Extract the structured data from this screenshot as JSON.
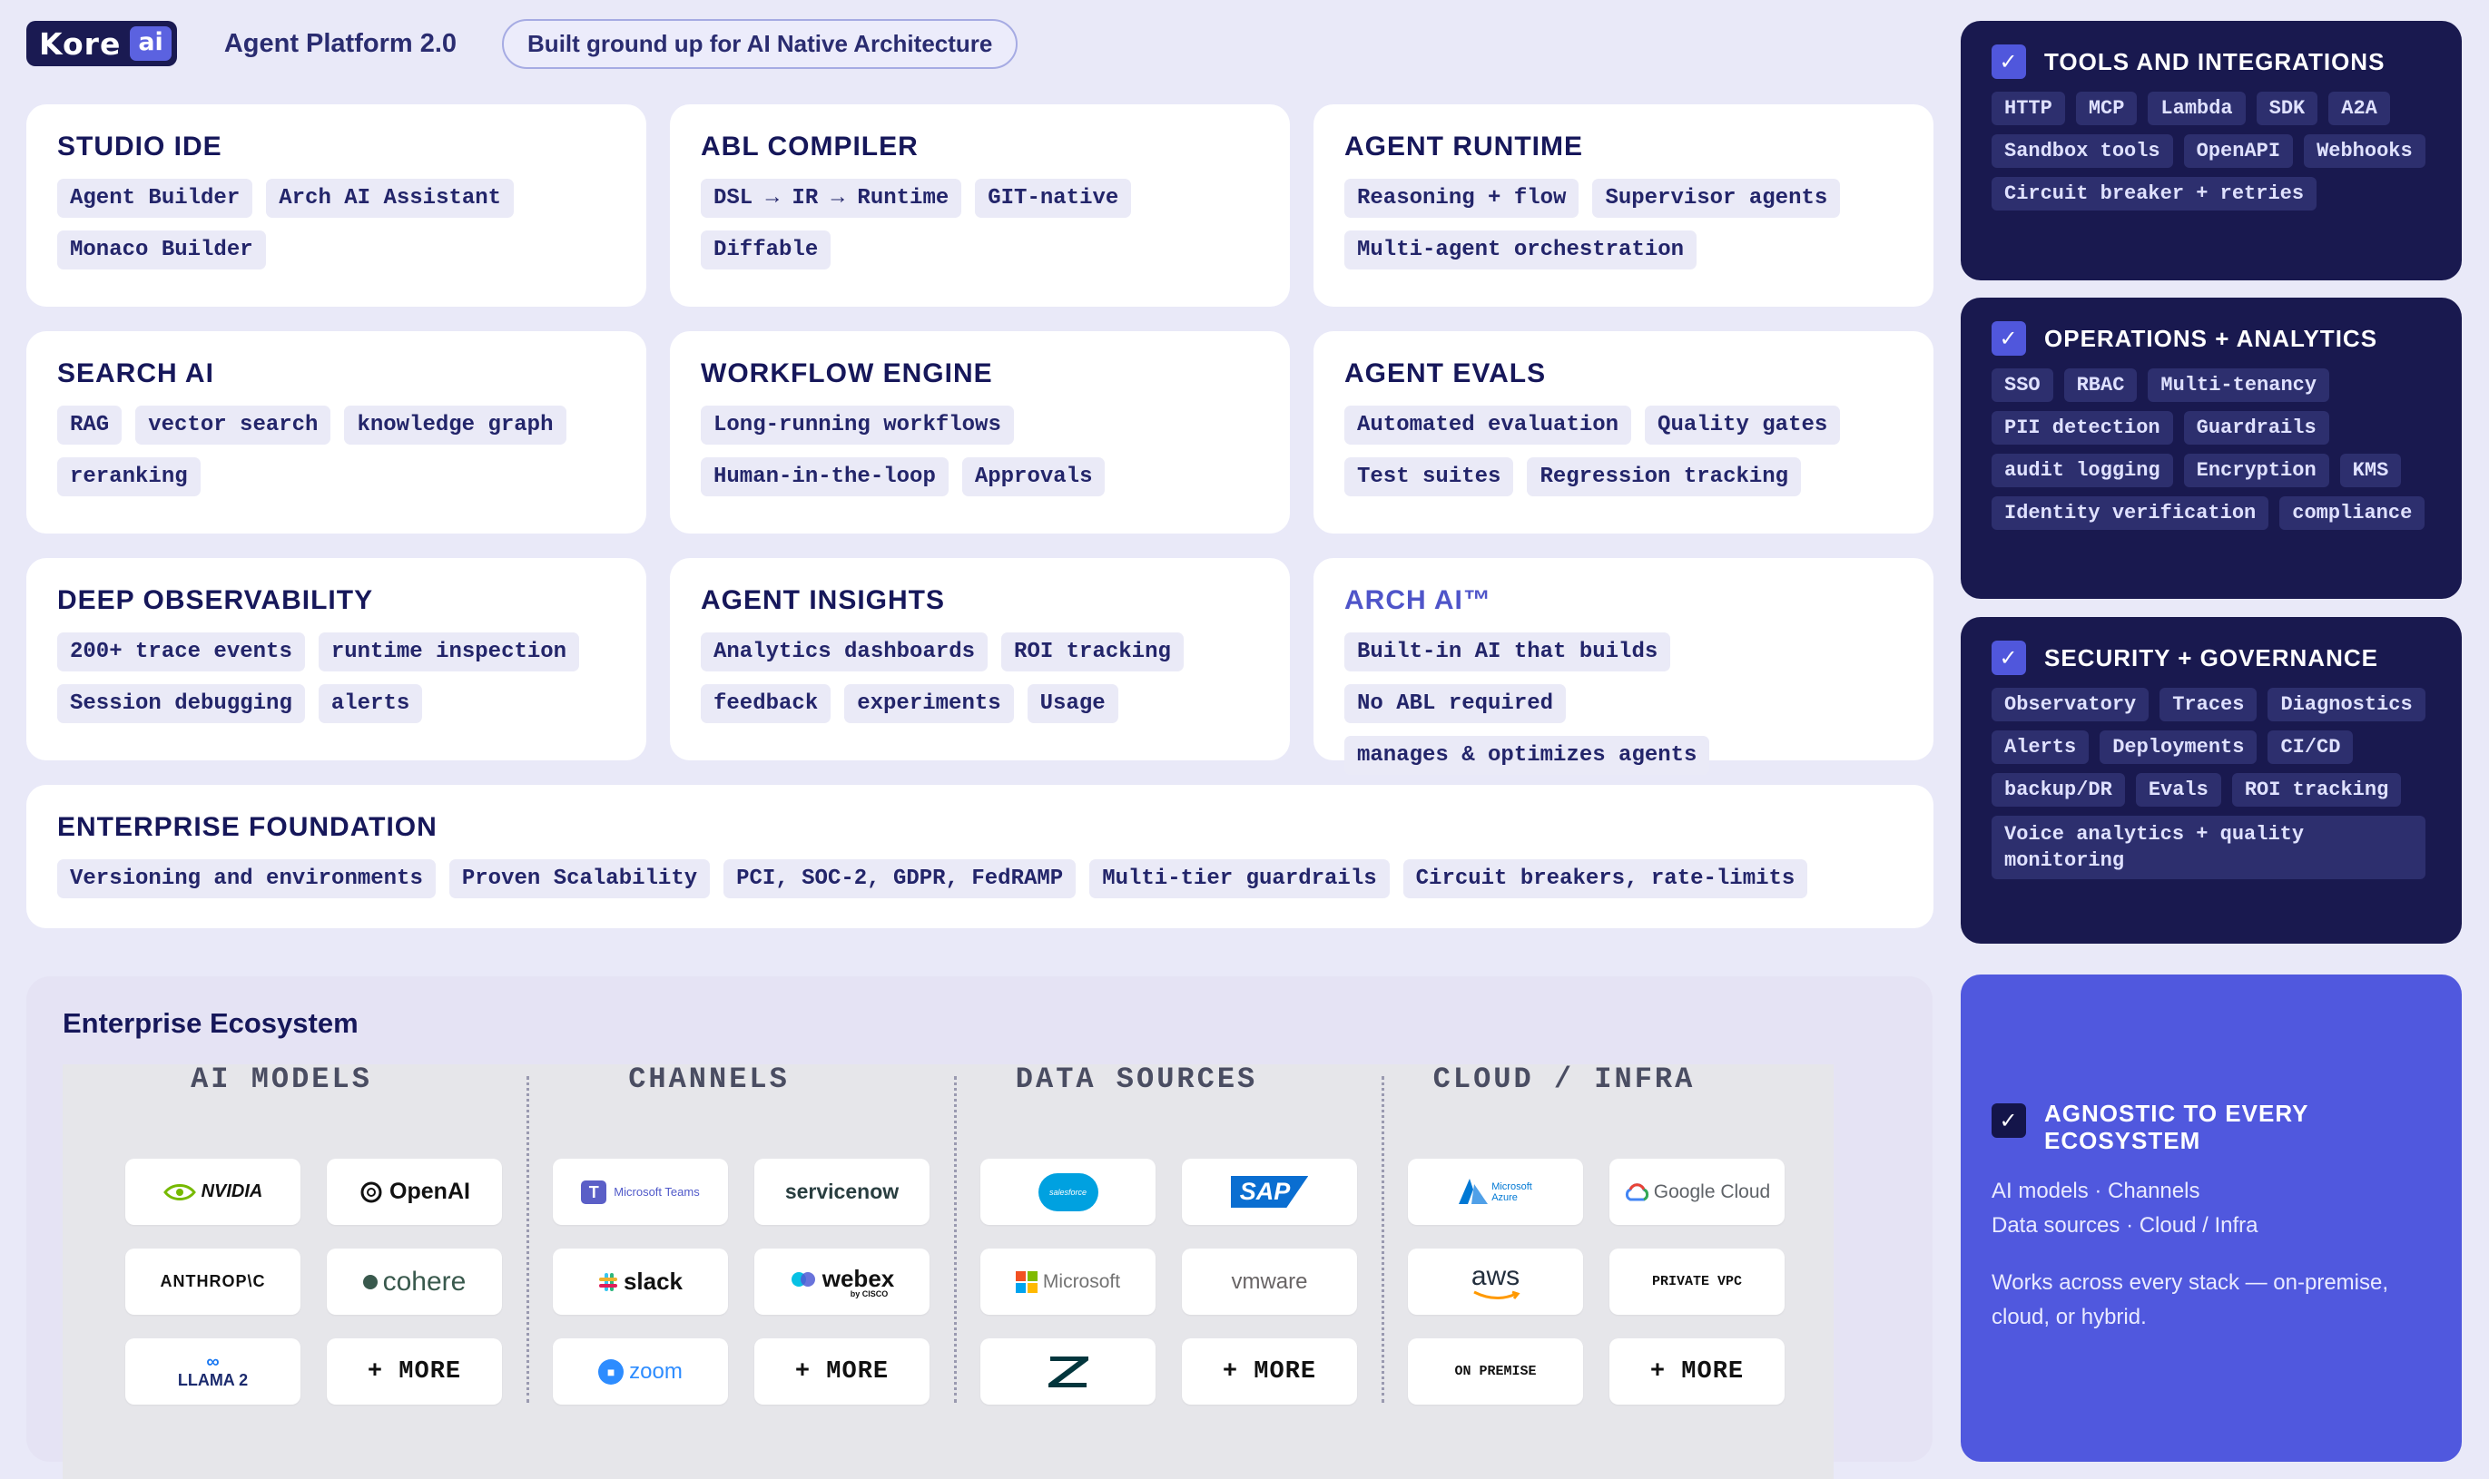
{
  "header": {
    "logo_word": "Kore",
    "logo_suffix": "ai",
    "platform": "Agent Platform 2.0",
    "tagline": "Built ground up for AI Native Architecture"
  },
  "cards": {
    "studio": {
      "title": "STUDIO IDE",
      "tags": [
        "Agent Builder",
        "Arch AI Assistant",
        "Monaco Builder"
      ]
    },
    "abl": {
      "title": "ABL COMPILER",
      "tags": [
        "DSL → IR → Runtime",
        "GIT-native",
        "Diffable"
      ]
    },
    "runtime": {
      "title": "AGENT RUNTIME",
      "tags": [
        "Reasoning + flow",
        "Supervisor agents",
        "Multi-agent orchestration"
      ]
    },
    "search": {
      "title": "SEARCH AI",
      "tags": [
        "RAG",
        "vector search",
        "knowledge graph",
        "reranking"
      ]
    },
    "workflow": {
      "title": "WORKFLOW ENGINE",
      "tags": [
        "Long-running workflows",
        "Human-in-the-loop",
        "Approvals"
      ]
    },
    "evals": {
      "title": "AGENT EVALS",
      "tags": [
        "Automated evaluation",
        "Quality gates",
        "Test suites",
        "Regression tracking"
      ]
    },
    "observ": {
      "title": "DEEP OBSERVABILITY",
      "tags": [
        "200+ trace events",
        "runtime inspection",
        "Session debugging",
        "alerts"
      ]
    },
    "insights": {
      "title": "AGENT INSIGHTS",
      "tags": [
        "Analytics dashboards",
        "ROI tracking",
        "feedback",
        "experiments",
        "Usage"
      ]
    },
    "arch": {
      "title": "ARCH AI™",
      "tags": [
        "Built-in AI that builds",
        "No ABL required",
        "manages & optimizes agents"
      ]
    },
    "foundation": {
      "title": "ENTERPRISE FOUNDATION",
      "tags": [
        "Versioning and environments",
        "Proven Scalability",
        "PCI, SOC-2, GDPR, FedRAMP",
        "Multi-tier guardrails",
        "Circuit breakers, rate-limits"
      ]
    }
  },
  "sidebar": {
    "tools": {
      "title": "TOOLS AND INTEGRATIONS",
      "tags": [
        "HTTP",
        "MCP",
        "Lambda",
        "SDK",
        "A2A",
        "Sandbox tools",
        "OpenAPI",
        "Webhooks",
        "Circuit breaker + retries"
      ]
    },
    "ops": {
      "title": "OPERATIONS + ANALYTICS",
      "tags": [
        "SSO",
        "RBAC",
        "Multi-tenancy",
        "PII detection",
        "Guardrails",
        "audit logging",
        "Encryption",
        "KMS",
        "Identity verification",
        "compliance"
      ]
    },
    "security": {
      "title": "SECURITY + GOVERNANCE",
      "tags": [
        "Observatory",
        "Traces",
        "Diagnostics",
        "Alerts",
        "Deployments",
        "CI/CD",
        "backup/DR",
        "Evals",
        "ROI tracking",
        "Voice analytics + quality monitoring"
      ]
    },
    "agnostic": {
      "title": "AGNOSTIC TO EVERY ECOSYSTEM",
      "line1": "AI models · Channels",
      "line2": "Data sources · Cloud / Infra",
      "line3": "Works across every stack — on-premise,",
      "line4": "cloud, or hybrid."
    }
  },
  "ecosystem": {
    "title": "Enterprise Ecosystem",
    "columns": [
      "AI MODELS",
      "CHANNELS",
      "DATA SOURCES",
      "CLOUD / INFRA"
    ],
    "logos": {
      "nvidia": "NVIDIA",
      "openai": "OpenAI",
      "anthropic": "ANTHROP\\C",
      "cohere": "cohere",
      "llama": "LLAMA 2",
      "teams": "Microsoft Teams",
      "servicenow": "servicenow",
      "slack": "slack",
      "webex": "webex",
      "webex_sub": "by CISCO",
      "zoom": "zoom",
      "salesforce": "salesforce",
      "sap": "SAP",
      "microsoft": "Microsoft",
      "vmware": "vmware",
      "azure_1": "Microsoft",
      "azure_2": "Azure",
      "gcloud": "Google Cloud",
      "aws": "aws",
      "private_vpc": "PRIVATE VPC",
      "on_premise": "ON PREMISE",
      "more": "+ MORE"
    }
  },
  "colors": {
    "navy": "#19194f",
    "indigo": "#5058de",
    "accent": "#4f55c9"
  }
}
